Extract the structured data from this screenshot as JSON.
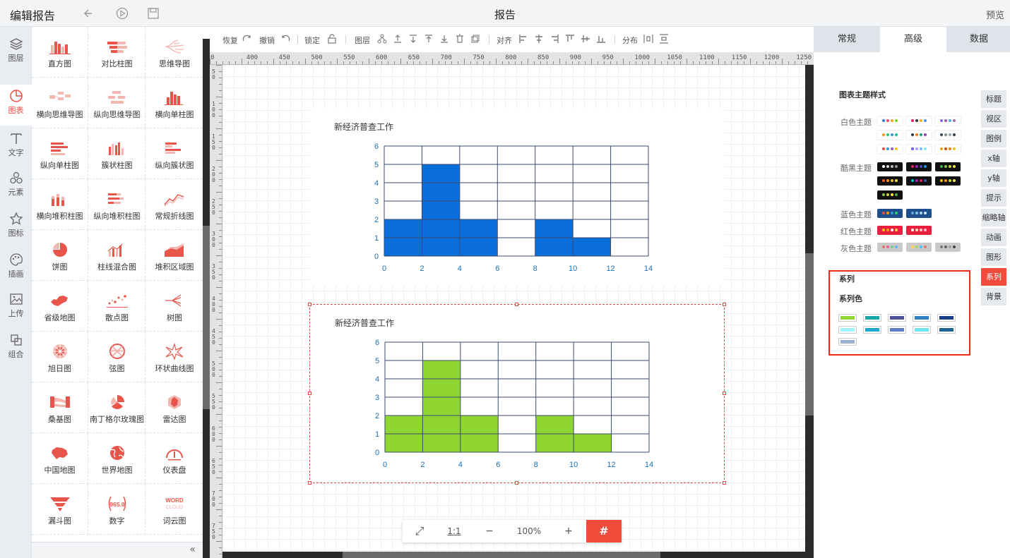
{
  "topbar": {
    "title": "编辑报告",
    "center": "报告",
    "preview": "预览"
  },
  "iconbar": [
    {
      "label": "图层",
      "icon": "layers-icon"
    },
    {
      "label": "图表",
      "icon": "chart-icon"
    },
    {
      "label": "文字",
      "icon": "text-icon"
    },
    {
      "label": "元素",
      "icon": "elements-icon"
    },
    {
      "label": "图标",
      "icon": "star-icon"
    },
    {
      "label": "插画",
      "icon": "palette-icon"
    },
    {
      "label": "上传",
      "icon": "image-upload-icon"
    },
    {
      "label": "组合",
      "icon": "group-icon"
    }
  ],
  "chart_types": [
    "直方图",
    "对比柱图",
    "思维导图",
    "横向思维导图",
    "纵向思维导图",
    "横向单柱图",
    "纵向单柱图",
    "簇状柱图",
    "纵向簇状图",
    "横向堆积柱图",
    "纵向堆积柱图",
    "常规折线图",
    "饼图",
    "柱线混合图",
    "堆积区域图",
    "省级地图",
    "散点图",
    "树图",
    "旭日图",
    "弦图",
    "环状曲线图",
    "桑基图",
    "南丁格尔玫瑰图",
    "雷达图",
    "中国地图",
    "世界地图",
    "仪表盘",
    "漏斗图",
    "数字",
    "词云图"
  ],
  "number_icon_text": "965.0",
  "wordcloud_icon_text": [
    "WORD",
    "CLOUD"
  ],
  "toolbar": {
    "redo": "恢复",
    "undo": "撤销",
    "lock": "锁定",
    "layer": "图层",
    "align": "对齐",
    "distribute": "分布"
  },
  "hruler_labels": [
    "0",
    "400",
    "450",
    "500",
    "550",
    "600",
    "650",
    "700",
    "750",
    "800",
    "850",
    "900",
    "950",
    "1000",
    "1050",
    "1100",
    "1150",
    "1200",
    "1250"
  ],
  "vruler_labels": [
    "50",
    "100",
    "150",
    "200",
    "250",
    "300",
    "350",
    "400",
    "450",
    "500",
    "550",
    "600",
    "650",
    "700",
    "750"
  ],
  "zoom": {
    "fit": "⤢",
    "one_to_one": "1:1",
    "minus": "−",
    "value": "100%",
    "plus": "+",
    "grid": "#"
  },
  "chart_data": [
    {
      "type": "bar",
      "title": "新经济普查工作",
      "x_edges": [
        0,
        2,
        4,
        6,
        8,
        10,
        12,
        14
      ],
      "values": [
        2,
        5,
        2,
        0,
        2,
        1,
        0
      ],
      "xlim": [
        0,
        14
      ],
      "ylim": [
        0,
        6
      ],
      "x_ticks": [
        0,
        2,
        4,
        6,
        8,
        10,
        12,
        14
      ],
      "y_ticks": [
        0,
        1,
        2,
        3,
        4,
        5,
        6
      ],
      "color": "#0a6fdb",
      "grid": true
    },
    {
      "type": "bar",
      "title": "新经济普查工作",
      "x_edges": [
        0,
        2,
        4,
        6,
        8,
        10,
        12,
        14
      ],
      "values": [
        2,
        5,
        2,
        0,
        2,
        1,
        0
      ],
      "xlim": [
        0,
        14
      ],
      "ylim": [
        0,
        6
      ],
      "x_ticks": [
        0,
        2,
        4,
        6,
        8,
        10,
        12,
        14
      ],
      "y_ticks": [
        0,
        1,
        2,
        3,
        4,
        5,
        6
      ],
      "color": "#8fd633",
      "grid": true
    }
  ],
  "rpanel": {
    "tabs": [
      "常规",
      "高级",
      "数据"
    ],
    "active_tab": "高级",
    "side_tabs": [
      "标题",
      "视区",
      "图例",
      "x轴",
      "y轴",
      "提示",
      "缩略轴",
      "动画",
      "图形",
      "系列",
      "背景"
    ],
    "active_side": "系列",
    "theme_section": "图表主题样式",
    "themes": [
      {
        "label": "白色主题",
        "rows": 3
      },
      {
        "label": "酷黑主题",
        "rows": 3
      },
      {
        "label": "蓝色主题",
        "rows": 1
      },
      {
        "label": "红色主题",
        "rows": 1
      },
      {
        "label": "灰色主题",
        "rows": 1
      }
    ],
    "series_section": "系列",
    "series_color_label": "系列色",
    "series_colors": [
      "#8fd633",
      "#1aa6a9",
      "#4d5098",
      "#2e82c4",
      "#1a3f86",
      "#9ef5ff",
      "#1ea6cf",
      "#5d7ec9",
      "#6fe6ef",
      "#1f6593",
      "#9ab0cf"
    ]
  },
  "accent": "#f24a3b"
}
